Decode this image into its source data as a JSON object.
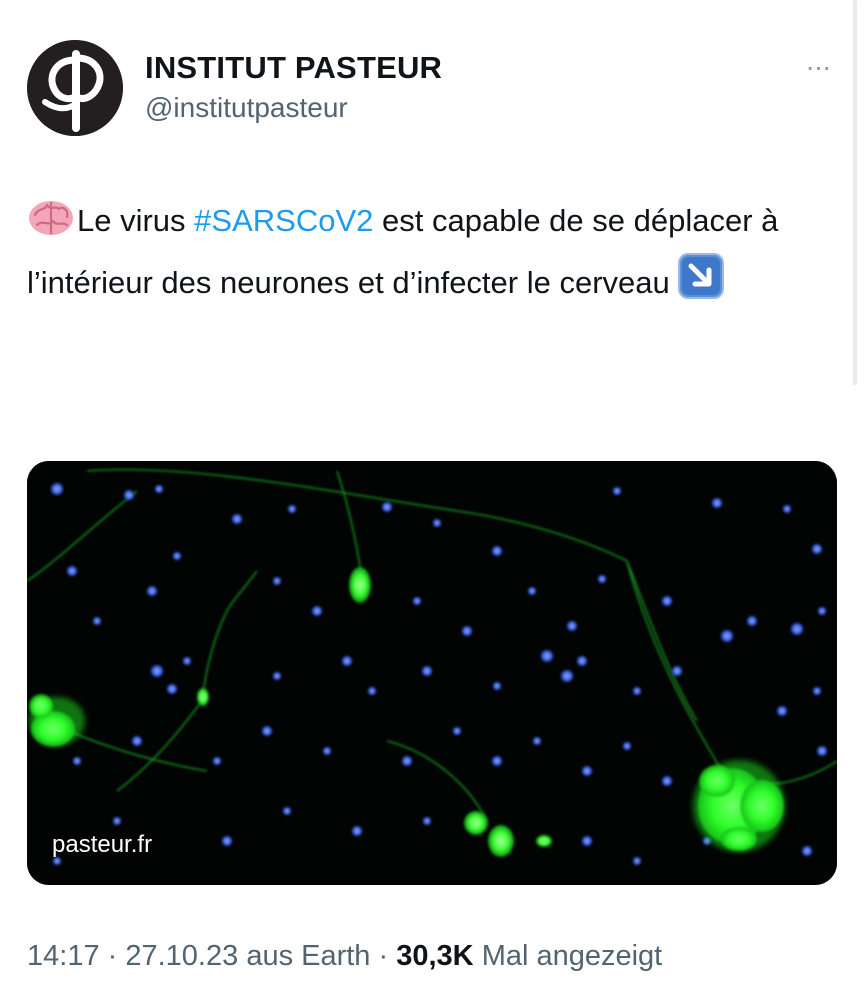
{
  "tweet": {
    "author_name": "INSTITUT PASTEUR",
    "author_handle": "@institutpasteur",
    "more_label": "···",
    "text_part1": "Le virus ",
    "hashtag": "#SARSCoV2",
    "text_part2": " est capable de se déplacer à l’intérieur des neurones et d’infecter le cerveau ",
    "leading_emoji": "brain-emoji",
    "trailing_emoji": "down-right-arrow-emoji",
    "media_source_label": "pasteur.fr",
    "time": "14:17",
    "date": "27.10.23",
    "source": "aus Earth",
    "views_count": "30,3K",
    "views_label": "Mal angezeigt",
    "sep": " · "
  },
  "colors": {
    "hashtag": "#1d9bf0",
    "secondary_text": "#536471",
    "primary_text": "#0f1419",
    "media_cells_green": "#39ff3a",
    "media_nuclei_blue": "#3a6bff"
  }
}
